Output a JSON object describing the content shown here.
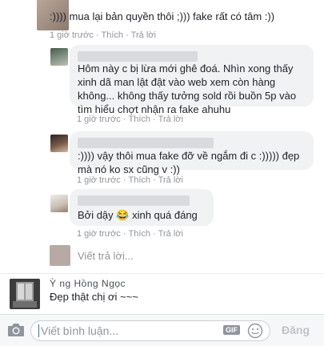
{
  "comment1": {
    "text": ":)))) mua lại bản quyền thôi ;))) fake rất có tâm :))",
    "time": "1 giờ trước",
    "like": "Thích",
    "reply": "Trả lời"
  },
  "reply1": {
    "text": "Hôm này c bị lừa mới ghê đoá. Nhìn xong thấy xinh dã man lật đật vào web xem còn hàng không... không thấy tưởng sold rồi buồn 5p vào tìm hiểu chợt nhận ra fake ahuhu",
    "time": "1 giờ trước",
    "like": "Thích",
    "reply": "Trả lời"
  },
  "reply2": {
    "text": ":)))) vậy thôi mua fake đỡ về ngắm đi c :))))) đẹp mà nó ko sx cũng v :))",
    "time": "1 giờ trước",
    "like": "Thích",
    "reply": "Trả lời"
  },
  "reply3": {
    "text": "Bởi dậy",
    "emoji": "😂",
    "text_after": "xinh quá đáng",
    "time": "1 giờ trước",
    "like": "Thích",
    "reply": "Trả lời"
  },
  "reply_input": {
    "placeholder": "Viết trả lời..."
  },
  "comment2": {
    "name": "Ỳ    ng  Hồng Ngọc",
    "text": "Đẹp thật chị ơi ~~~"
  },
  "composer": {
    "placeholder": "Viết bình luận...",
    "gif_label": "GIF",
    "send_label": "Đăng"
  },
  "icons": {
    "camera": "camera-icon",
    "gif": "gif-icon",
    "emoji": "emoji-icon"
  },
  "colors": {
    "link_blue": "#4267b2",
    "meta_gray": "#90949c",
    "bubble_gray": "#f1f2f4"
  }
}
